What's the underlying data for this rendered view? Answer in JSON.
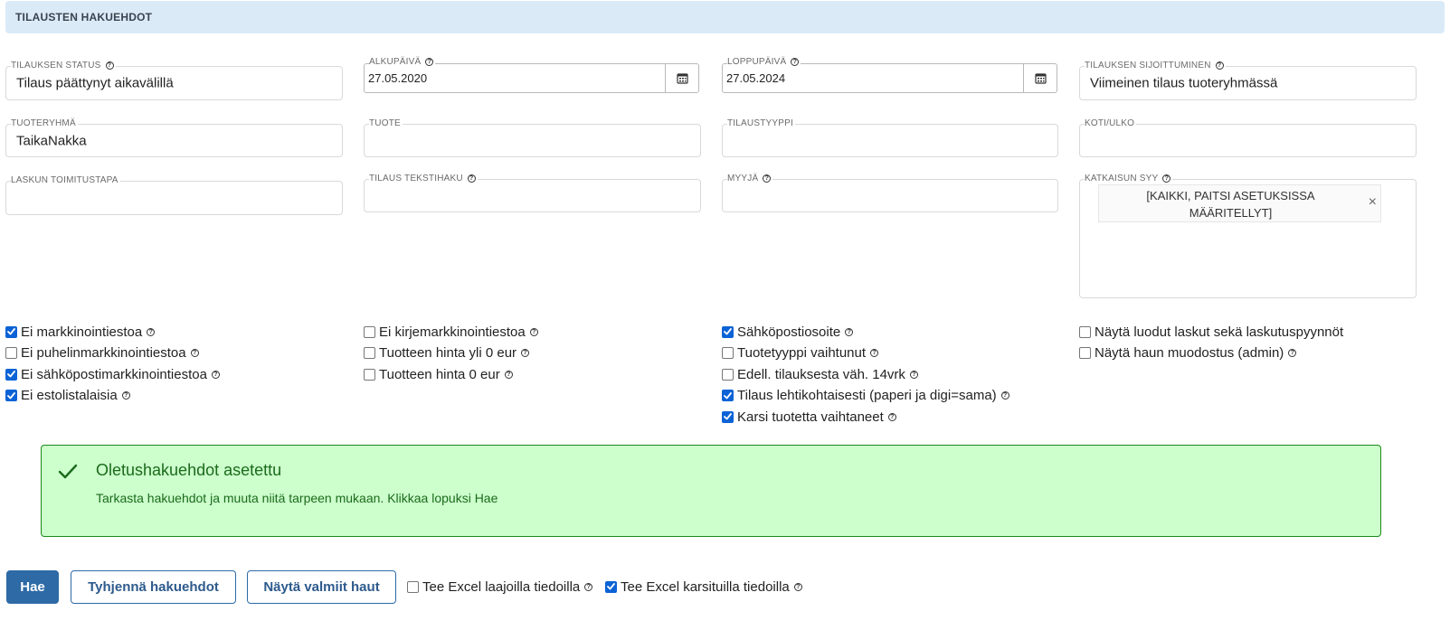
{
  "header": {
    "title": "TILAUSTEN HAKUEHDOT"
  },
  "fields": {
    "status": {
      "label": "TILAUKSEN STATUS",
      "value": "Tilaus päättynyt aikavälillä"
    },
    "start_date": {
      "label": "ALKUPÄIVÄ",
      "value": "27.05.2020"
    },
    "end_date": {
      "label": "LOPPUPÄIVÄ",
      "value": "27.05.2024"
    },
    "placement": {
      "label": "TILAUKSEN SIJOITTUMINEN",
      "value": "Viimeinen tilaus tuoteryhmässä"
    },
    "product_group": {
      "label": "TUOTERYHMÄ",
      "value": "TaikaNakka"
    },
    "product": {
      "label": "TUOTE",
      "value": ""
    },
    "order_type": {
      "label": "TILAUSTYYPPI",
      "value": ""
    },
    "domestic": {
      "label": "KOTI/ULKO",
      "value": ""
    },
    "delivery": {
      "label": "LASKUN TOIMITUSTAPA",
      "value": ""
    },
    "text_search": {
      "label": "TILAUS TEKSTIHAKU",
      "value": ""
    },
    "seller": {
      "label": "MYYJÄ",
      "value": ""
    },
    "cancel_reason": {
      "label": "KATKAISUN SYY",
      "tag": "[KAIKKI, PAITSI ASETUKSISSA MÄÄRITELLYT]",
      "tag_close": "×"
    }
  },
  "checkboxes": {
    "col1": [
      {
        "label": "Ei markkinointiestoa",
        "checked": true,
        "help": true
      },
      {
        "label": "Ei puhelinmarkkinointiestoa",
        "checked": false,
        "help": true
      },
      {
        "label": "Ei sähköpostimarkkinointiestoa",
        "checked": true,
        "help": true
      },
      {
        "label": "Ei estolistalaisia",
        "checked": true,
        "help": true
      }
    ],
    "col2": [
      {
        "label": "Ei kirjemarkkinointiestoa",
        "checked": false,
        "help": true
      },
      {
        "label": "Tuotteen hinta yli 0 eur",
        "checked": false,
        "help": true
      },
      {
        "label": "Tuotteen hinta 0 eur",
        "checked": false,
        "help": true
      }
    ],
    "col3": [
      {
        "label": "Sähköpostiosoite",
        "checked": true,
        "help": true
      },
      {
        "label": "Tuotetyyppi vaihtunut",
        "checked": false,
        "help": true
      },
      {
        "label": "Edell. tilauksesta väh. 14vrk",
        "checked": false,
        "help": true
      },
      {
        "label": "Tilaus lehtikohtaisesti (paperi ja digi=sama)",
        "checked": true,
        "help": true
      },
      {
        "label": "Karsi tuotetta vaihtaneet",
        "checked": true,
        "help": true
      }
    ],
    "col4": [
      {
        "label": "Näytä luodut laskut sekä laskutuspyynnöt",
        "checked": false,
        "help": false
      },
      {
        "label": "Näytä haun muodostus (admin)",
        "checked": false,
        "help": true
      }
    ]
  },
  "notice": {
    "title": "Oletushakuehdot asetettu",
    "text": "Tarkasta hakuehdot ja muuta niitä tarpeen mukaan. Klikkaa lopuksi Hae"
  },
  "actions": {
    "search": "Hae",
    "clear": "Tyhjennä hakuehdot",
    "saved": "Näytä valmiit haut",
    "excel_wide": {
      "label": "Tee Excel laajoilla tiedoilla",
      "checked": false
    },
    "excel_pruned": {
      "label": "Tee Excel karsituilla tiedoilla",
      "checked": true
    }
  },
  "help_glyph": "?",
  "colors": {
    "accent": "#2d6aa6",
    "checkbox": "#0b63d6",
    "notice_bg": "#ccffcc",
    "notice_text": "#1b6a1b",
    "header_bg": "#dbeaf7"
  }
}
